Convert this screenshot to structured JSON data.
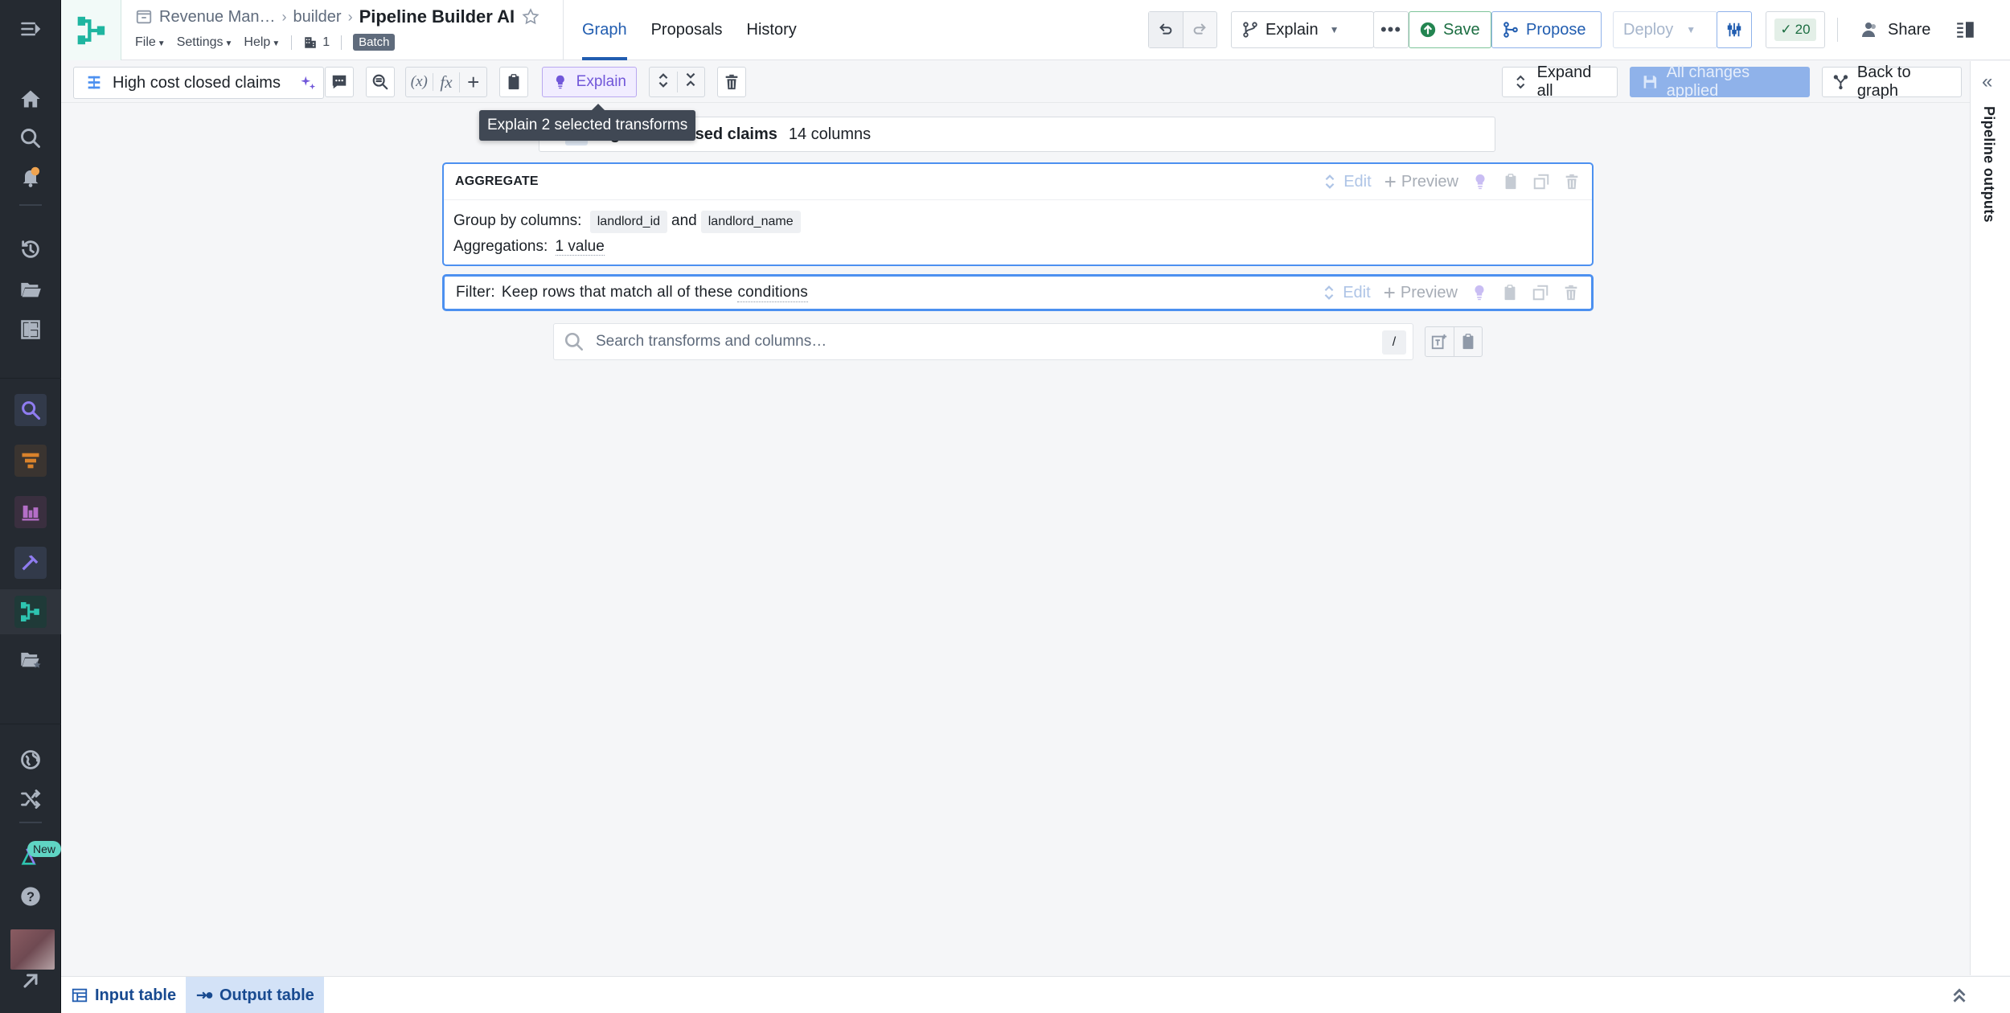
{
  "nav": {
    "items": [
      {
        "name": "menu-toggle-icon"
      },
      {
        "name": "home-icon"
      },
      {
        "name": "search-icon"
      },
      {
        "name": "notifications-icon"
      },
      {
        "name": "recent-icon"
      },
      {
        "name": "files-icon"
      },
      {
        "name": "workspace-icon"
      },
      {
        "name": "quiver-icon"
      },
      {
        "name": "contour-icon"
      },
      {
        "name": "charts-icon"
      },
      {
        "name": "build-icon"
      },
      {
        "name": "pipeline-builder-icon"
      },
      {
        "name": "favorites-folder-icon"
      },
      {
        "name": "globe-icon"
      },
      {
        "name": "shuffle-icon"
      },
      {
        "name": "aip-icon"
      },
      {
        "name": "help-icon"
      },
      {
        "name": "expand-icon"
      }
    ],
    "new_badge": "New"
  },
  "header": {
    "breadcrumbs": [
      "Revenue Man…",
      "builder"
    ],
    "title": "Pipeline Builder AI",
    "menus": [
      "File",
      "Settings",
      "Help"
    ],
    "branch_count": "1",
    "mode_badge": "Batch",
    "tabs": [
      {
        "label": "Graph",
        "active": true
      },
      {
        "label": "Proposals",
        "active": false
      },
      {
        "label": "History",
        "active": false
      }
    ],
    "explain_label": "Explain",
    "save_label": "Save",
    "propose_label": "Propose",
    "deploy_label": "Deploy",
    "checks_count": "20",
    "share_label": "Share"
  },
  "toolbar": {
    "path_name": "High cost closed claims",
    "explain_label": "Explain",
    "expand_all_label": "Expand all",
    "changes_label": "All changes applied",
    "back_label": "Back to graph",
    "tooltip": "Explain 2 selected transforms"
  },
  "canvas": {
    "source": {
      "name": "High cost closed claims",
      "visible_name": "aims",
      "columns": "14 columns"
    },
    "aggregate": {
      "title": "AGGREGATE",
      "group_label": "Group by columns:",
      "group_cols": [
        "landlord_id",
        "landlord_name"
      ],
      "joiner": "and",
      "agg_label": "Aggregations:",
      "agg_value": "1 value"
    },
    "filter": {
      "label": "Filter:",
      "text_before": "Keep rows that match all of these",
      "text_link": "conditions"
    },
    "card_actions": {
      "edit": "Edit",
      "preview": "Preview"
    },
    "search": {
      "placeholder": "Search transforms and columns…",
      "shortcut": "/"
    }
  },
  "right_panel": {
    "label": "Pipeline outputs"
  },
  "bottom": {
    "tabs": [
      {
        "label": "Input table",
        "active": false
      },
      {
        "label": "Output table",
        "active": true
      }
    ]
  },
  "colors": {
    "accent": "#215db0",
    "explain": "#7157d9",
    "save": "#238551",
    "node_border": "#4c90f0"
  }
}
